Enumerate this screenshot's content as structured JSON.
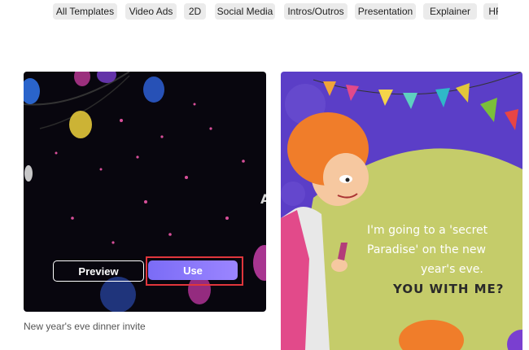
{
  "tabs": [
    {
      "label": "All Templates"
    },
    {
      "label": "Video Ads"
    },
    {
      "label": "2D"
    },
    {
      "label": "Social Media"
    },
    {
      "label": "Intros/Outros"
    },
    {
      "label": "Presentation"
    },
    {
      "label": "Explainer"
    },
    {
      "label": "HR"
    }
  ],
  "templates": [
    {
      "title": "New year's eve dinner invite",
      "preview_label": "Preview",
      "use_label": "Use"
    },
    {
      "text_lines": [
        "I'm going to a 'secret",
        "Paradise' on the new",
        "year's eve."
      ],
      "shout": "YOU WITH ME?"
    }
  ],
  "colors": {
    "use_button": "#8a78fb",
    "highlight": "#e0363c",
    "card2_bg": "#5b3ec7",
    "card2_blob": "#c5cc6a"
  }
}
